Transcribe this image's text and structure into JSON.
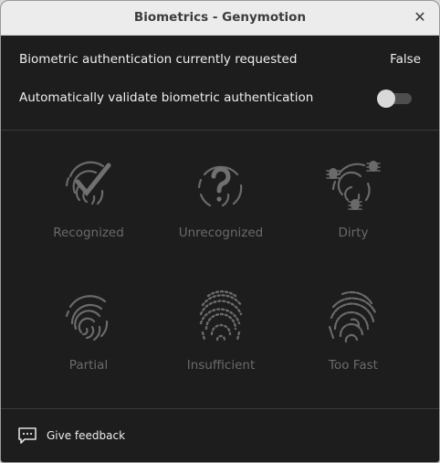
{
  "window": {
    "title": "Biometrics - Genymotion",
    "close_symbol": "✕"
  },
  "status": {
    "label": "Biometric authentication currently requested",
    "value": "False"
  },
  "auto_validate": {
    "label": "Automatically validate biometric authentication",
    "enabled": false
  },
  "fingerprints": [
    {
      "label": "Recognized",
      "icon": "fingerprint-check-icon"
    },
    {
      "label": "Unrecognized",
      "icon": "fingerprint-question-icon"
    },
    {
      "label": "Dirty",
      "icon": "fingerprint-bugs-icon"
    },
    {
      "label": "Partial",
      "icon": "fingerprint-partial-icon"
    },
    {
      "label": "Insufficient",
      "icon": "fingerprint-dotted-icon"
    },
    {
      "label": "Too Fast",
      "icon": "fingerprint-smudged-icon"
    }
  ],
  "footer": {
    "feedback_label": "Give feedback",
    "icon": "chat-icon"
  },
  "colors": {
    "background": "#1d1d1d",
    "icon": "#6a6a6a",
    "text": "#eeeeee",
    "disabled_text": "#6a6a6a"
  }
}
